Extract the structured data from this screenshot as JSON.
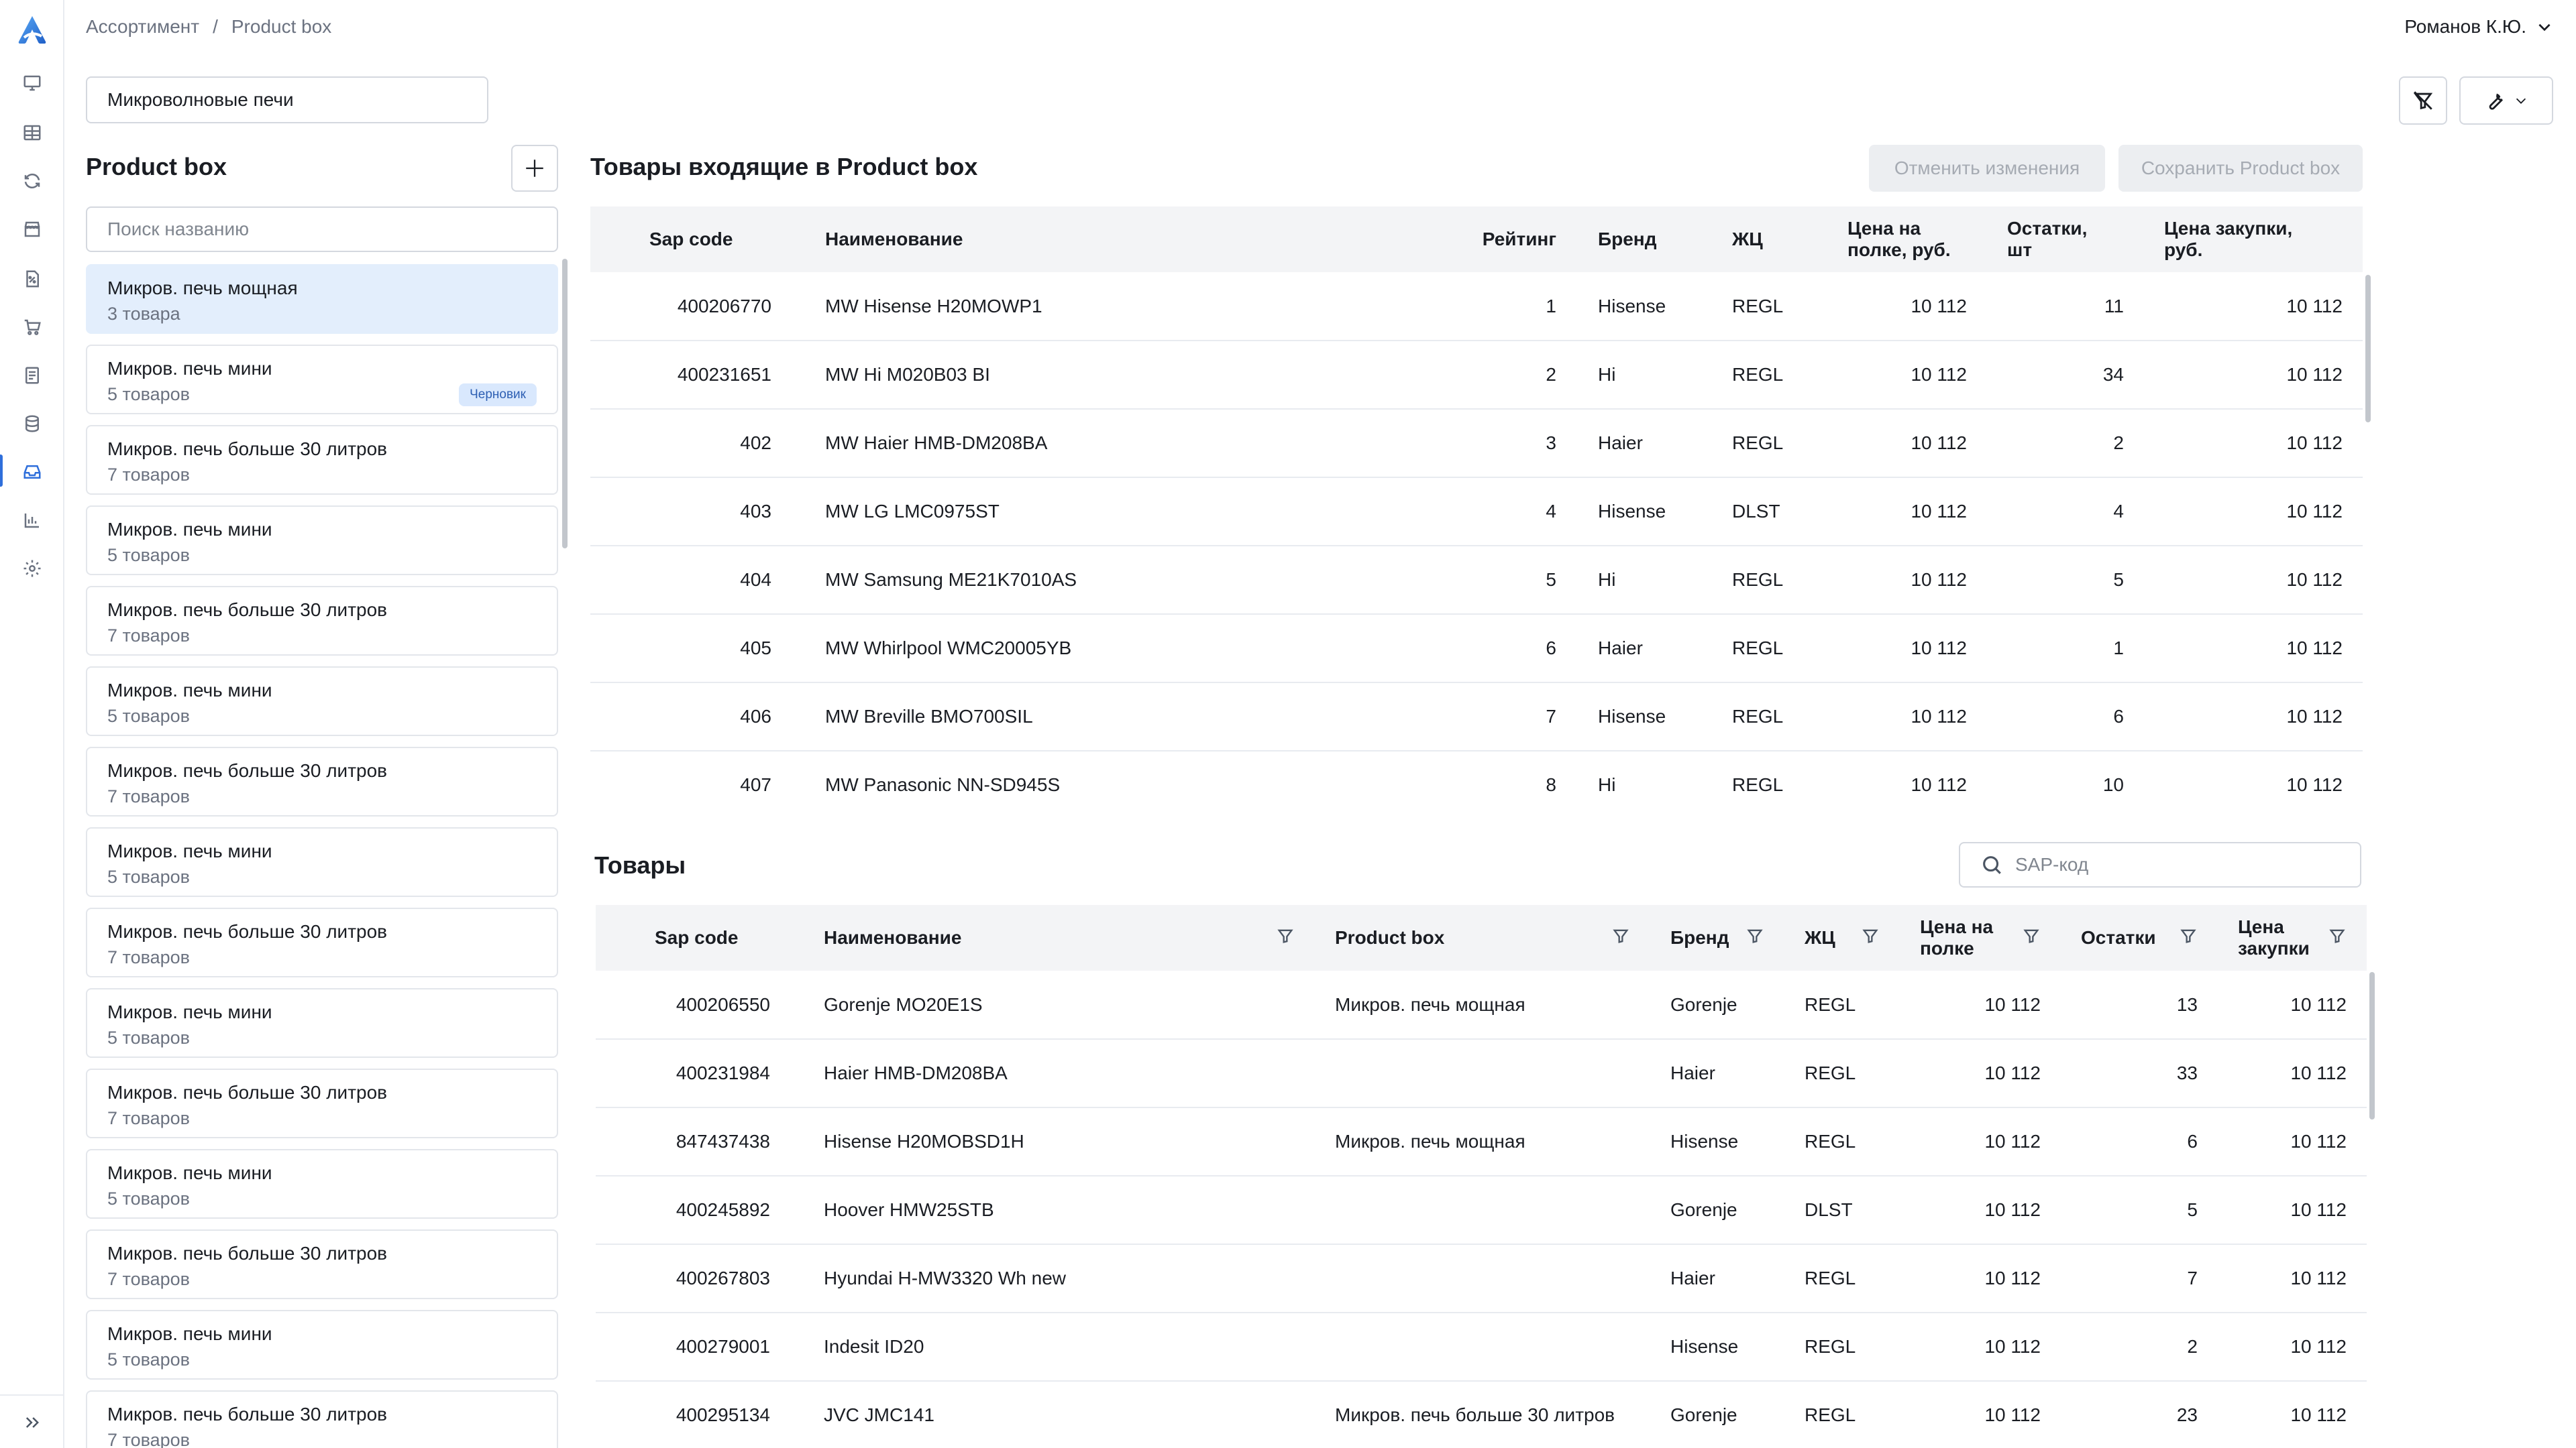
{
  "breadcrumb": {
    "root": "Ассортимент",
    "separator": "/",
    "current": "Product box"
  },
  "user": {
    "name": "Романов К.Ю."
  },
  "category": {
    "value": "Микроволновые печи"
  },
  "product_box_panel": {
    "title": "Product box",
    "search_placeholder": "Поиск названию",
    "items": [
      {
        "name": "Микров. печь мощная",
        "count": "3 товара",
        "selected": true
      },
      {
        "name": "Микров. печь мини",
        "count": "5 товаров",
        "badge": "Черновик"
      },
      {
        "name": "Микров. печь больше 30 литров",
        "count": "7 товаров"
      },
      {
        "name": "Микров. печь мини",
        "count": "5 товаров"
      },
      {
        "name": "Микров. печь больше 30 литров",
        "count": "7 товаров"
      },
      {
        "name": "Микров. печь мини",
        "count": "5 товаров"
      },
      {
        "name": "Микров. печь больше 30 литров",
        "count": "7 товаров"
      },
      {
        "name": "Микров. печь мини",
        "count": "5 товаров"
      },
      {
        "name": "Микров. печь больше 30 литров",
        "count": "7 товаров"
      },
      {
        "name": "Микров. печь мини",
        "count": "5 товаров"
      },
      {
        "name": "Микров. печь больше 30 литров",
        "count": "7 товаров"
      },
      {
        "name": "Микров. печь мини",
        "count": "5 товаров"
      },
      {
        "name": "Микров. печь больше 30 литров",
        "count": "7 товаров"
      },
      {
        "name": "Микров. печь мини",
        "count": "5 товаров"
      },
      {
        "name": "Микров. печь больше 30 литров",
        "count": "7 товаров"
      }
    ]
  },
  "included": {
    "title": "Товары входящие в Product box",
    "cancel_label": "Отменить изменения",
    "save_label": "Сохранить Product box",
    "columns": [
      "Sap code",
      "Наименование",
      "Рейтинг",
      "Бренд",
      "ЖЦ",
      "Цена на полке, руб.",
      "Остатки, шт",
      "Цена закупки, руб."
    ],
    "rows": [
      [
        "400206770",
        "MW Hisense H20MOWP1",
        "1",
        "Hisense",
        "REGL",
        "10 112",
        "11",
        "10 112"
      ],
      [
        "400231651",
        "MW Hi M020B03 BI",
        "2",
        "Hi",
        "REGL",
        "10 112",
        "34",
        "10 112"
      ],
      [
        "402",
        "MW Haier HMB-DM208BA",
        "3",
        "Haier",
        "REGL",
        "10 112",
        "2",
        "10 112"
      ],
      [
        "403",
        "MW LG LMC0975ST",
        "4",
        "Hisense",
        "DLST",
        "10 112",
        "4",
        "10 112"
      ],
      [
        "404",
        "MW Samsung ME21K7010AS",
        "5",
        "Hi",
        "REGL",
        "10 112",
        "5",
        "10 112"
      ],
      [
        "405",
        "MW Whirlpool WMC20005YB",
        "6",
        "Haier",
        "REGL",
        "10 112",
        "1",
        "10 112"
      ],
      [
        "406",
        "MW Breville BMO700SIL",
        "7",
        "Hisense",
        "REGL",
        "10 112",
        "6",
        "10 112"
      ],
      [
        "407",
        "MW Panasonic NN-SD945S",
        "8",
        "Hi",
        "REGL",
        "10 112",
        "10",
        "10 112"
      ]
    ]
  },
  "products": {
    "title": "Товары",
    "search_placeholder": "SAP-код",
    "columns": [
      "Sap code",
      "Наименование",
      "Product box",
      "Бренд",
      "ЖЦ",
      "Цена на полке",
      "Остатки",
      "Цена закупки"
    ],
    "rows": [
      [
        "400206550",
        "Gorenje MO20E1S",
        "Микров. печь мощная",
        "Gorenje",
        "REGL",
        "10 112",
        "13",
        "10 112"
      ],
      [
        "400231984",
        "Haier HMB-DM208BA",
        "",
        "Haier",
        "REGL",
        "10 112",
        "33",
        "10 112"
      ],
      [
        "847437438",
        "Hisense H20MOBSD1H",
        "Микров. печь мощная",
        "Hisense",
        "REGL",
        "10 112",
        "6",
        "10 112"
      ],
      [
        "400245892",
        "Hoover HMW25STB",
        "",
        "Gorenje",
        "DLST",
        "10 112",
        "5",
        "10 112"
      ],
      [
        "400267803",
        "Hyundai H-MW3320 Wh new",
        "",
        "Haier",
        "REGL",
        "10 112",
        "7",
        "10 112"
      ],
      [
        "400279001",
        "Indesit ID20",
        "",
        "Hisense",
        "REGL",
        "10 112",
        "2",
        "10 112"
      ],
      [
        "400295134",
        "JVC JMC141",
        "Микров. печь больше 30 литров",
        "Gorenje",
        "REGL",
        "10 112",
        "23",
        "10 112"
      ]
    ]
  },
  "colors": {
    "accent": "#2f6fdb",
    "selected_bg": "#e3eefc",
    "badge_bg": "#d9e8fd",
    "header_bg": "#f3f4f6"
  }
}
